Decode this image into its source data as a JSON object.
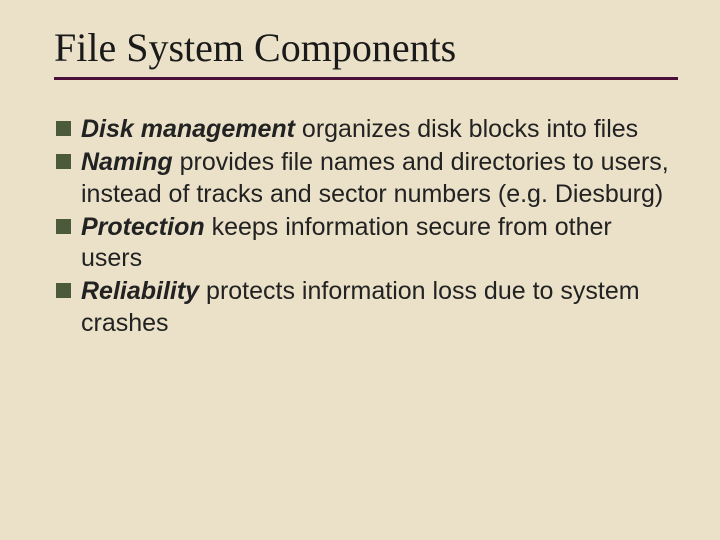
{
  "title": "File System Components",
  "bullets": [
    {
      "term": "Disk management",
      "rest": " organizes disk blocks into files"
    },
    {
      "term": "Naming",
      "rest": " provides file names and directories to users, instead of tracks and sector numbers (e.g. Diesburg)"
    },
    {
      "term": "Protection",
      "rest": " keeps information secure from other users"
    },
    {
      "term": "Reliability",
      "rest": " protects information loss due to system crashes"
    }
  ]
}
